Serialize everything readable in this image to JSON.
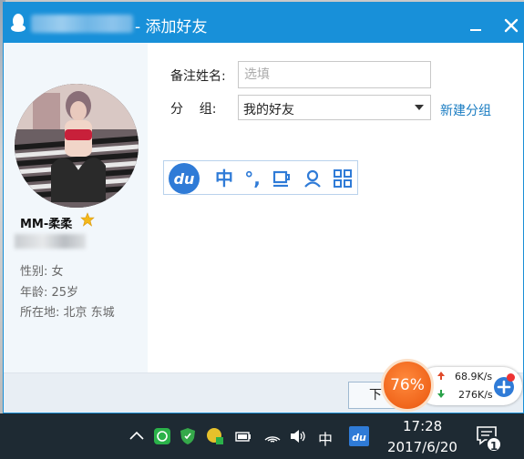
{
  "window": {
    "title": "- 添加好友"
  },
  "profile": {
    "name": "MM-柔柔",
    "gender_line": "性别: 女",
    "age_line": "年龄: 25岁",
    "location_line": "所在地: 北京  东城"
  },
  "form": {
    "remark_label": "备注姓名:",
    "remark_placeholder": "选填",
    "group_label": "分    组:",
    "group_value": "我的好友",
    "new_group_link": "新建分组"
  },
  "ime": {
    "logo_text": "du",
    "buttons": [
      "中",
      "°,",
      "",
      "",
      ""
    ]
  },
  "footer": {
    "next_label": "下"
  },
  "net_widget": {
    "percent": "76%",
    "upload": "68.9K/s",
    "download": "276K/s"
  },
  "taskbar": {
    "ime_indicator": "中",
    "time": "17:28",
    "date": "2017/6/20",
    "notification_count": "1"
  },
  "colors": {
    "title_bar": "#1890d9",
    "link": "#1a7cc2",
    "ime_blue": "#2f7bd7",
    "net_orange": "#f0651b",
    "taskbar": "#1e2a33"
  }
}
